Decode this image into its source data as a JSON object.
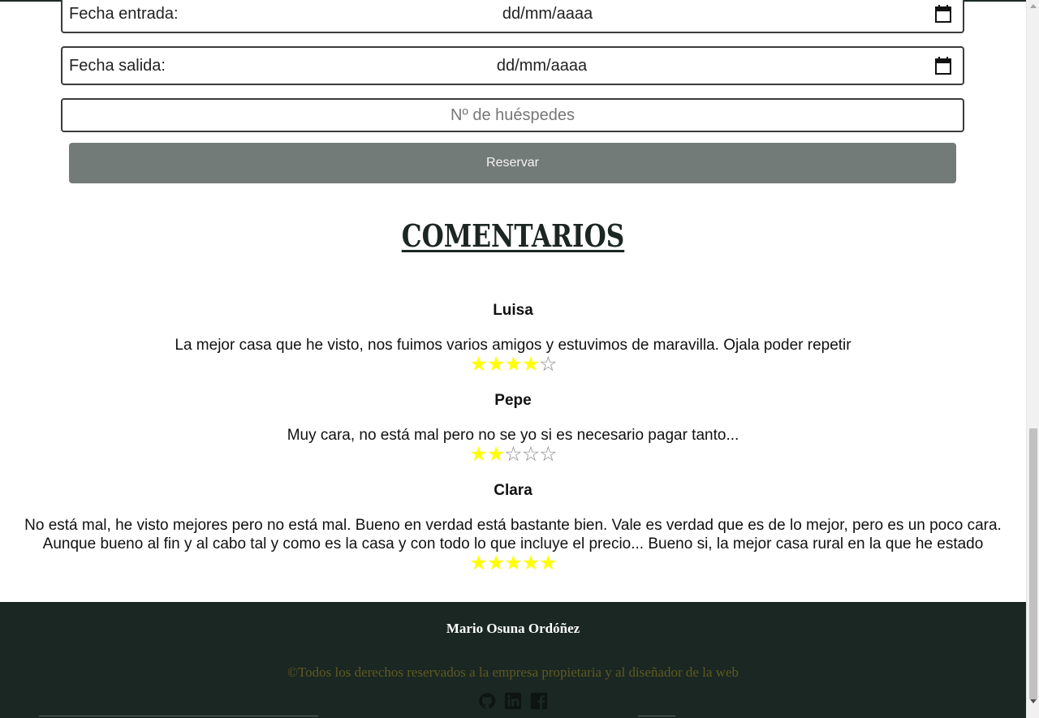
{
  "booking_form": {
    "entrada_label": "Fecha entrada:",
    "entrada_value": "dd/mm/aaaa",
    "salida_label": "Fecha salida:",
    "salida_value": "dd/mm/aaaa",
    "guests_placeholder": "Nº de huéspedes",
    "reserve_button": "Reservar"
  },
  "comments": {
    "title": "COMENTARIOS",
    "items": [
      {
        "author": "Luisa",
        "text": "La mejor casa que he visto, nos fuimos varios amigos y estuvimos de maravilla. Ojala poder repetir",
        "rating": 4,
        "max": 5
      },
      {
        "author": "Pepe",
        "text": "Muy cara, no está mal pero no se yo si es necesario pagar tanto...",
        "rating": 2,
        "max": 5
      },
      {
        "author": "Clara",
        "text": "No está mal, he visto mejores pero no está mal. Bueno en verdad está bastante bien. Vale es verdad que es de lo mejor, pero es un poco cara. Aunque bueno al fin y al cabo tal y como es la casa y con todo lo que incluye el precio... Bueno si, la mejor casa rural en la que he estado",
        "rating": 5,
        "max": 5
      }
    ],
    "star_filled_color": "#ffff00",
    "star_empty_color": "#888888"
  },
  "footer": {
    "name": "Mario Osuna Ordóñez",
    "rights": "©Todos los derechos reservados a la empresa propietaria y al diseñador de la web",
    "social_icons": [
      "github-icon",
      "linkedin-icon",
      "facebook-icon"
    ],
    "background": "#1a2723"
  },
  "scroll_position": 0.62
}
